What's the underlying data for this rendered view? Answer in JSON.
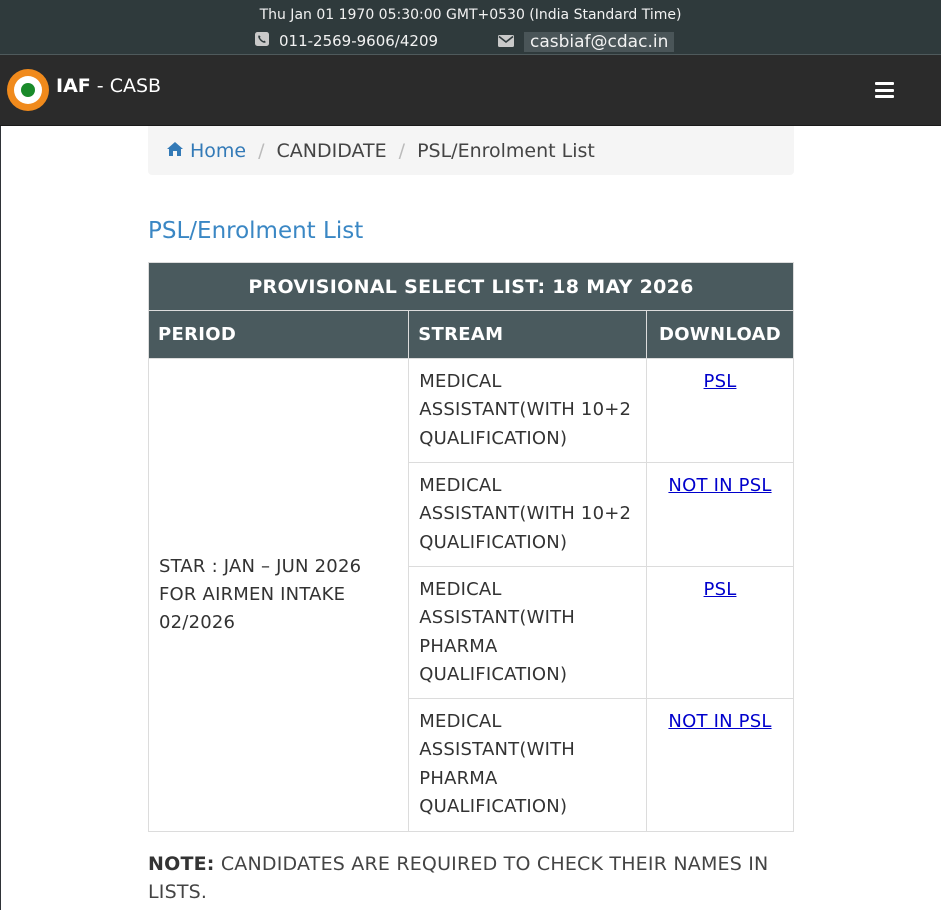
{
  "topbar": {
    "datetime": "Thu Jan 01 1970 05:30:00 GMT+0530 (India Standard Time)",
    "phone": "011-2569-9606/4209",
    "email": "casbiaf@cdac.in",
    "phone_icon": "phone-icon",
    "email_icon": "envelope-icon"
  },
  "navbar": {
    "brand_bold": "IAF",
    "brand_rest": " - CASB",
    "menu_icon": "hamburger-menu-icon"
  },
  "breadcrumb": {
    "home": "Home",
    "section": "CANDIDATE",
    "current": "PSL/Enrolment List"
  },
  "page": {
    "title": "PSL/Enrolment List"
  },
  "table": {
    "caption": "PROVISIONAL SELECT LIST: 18 MAY 2026",
    "headers": [
      "PERIOD",
      "STREAM",
      "DOWNLOAD"
    ],
    "period": "STAR : JAN – JUN 2026 FOR AIRMEN INTAKE 02/2026",
    "rows": [
      {
        "stream": "MEDICAL ASSISTANT(WITH 10+2 QUALIFICATION)",
        "download": "PSL"
      },
      {
        "stream": "MEDICAL ASSISTANT(WITH 10+2 QUALIFICATION)",
        "download": "NOT IN PSL"
      },
      {
        "stream": "MEDICAL ASSISTANT(WITH PHARMA QUALIFICATION)",
        "download": "PSL"
      },
      {
        "stream": "MEDICAL ASSISTANT(WITH PHARMA QUALIFICATION)",
        "download": "NOT IN PSL"
      }
    ]
  },
  "note": {
    "label": "NOTE:",
    "text": " CANDIDATES ARE REQUIRED TO CHECK THEIR NAMES IN LISTS."
  },
  "colors": {
    "topbar_bg": "#2f3a3c",
    "navbar_bg": "#2b2b2b",
    "table_header_bg": "#4a5a5e",
    "link": "#0000cc",
    "title": "#3a87c4"
  }
}
